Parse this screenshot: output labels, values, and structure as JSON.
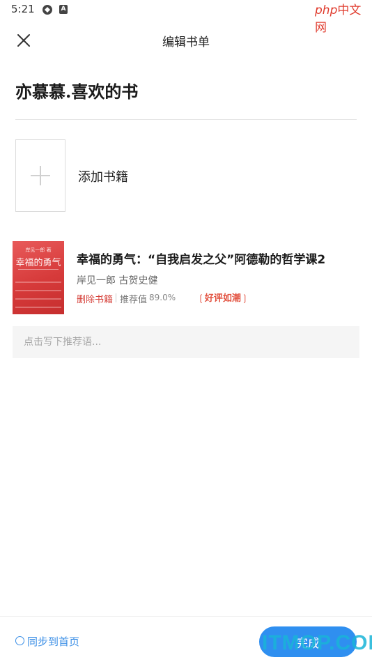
{
  "status_bar": {
    "time": "5:21",
    "icon_b": "A"
  },
  "watermark_top": {
    "brand": "php",
    "suffix": "中文网"
  },
  "header": {
    "title": "编辑书单",
    "close_icon": "close-icon"
  },
  "booklist": {
    "name": "亦慕慕.喜欢的书"
  },
  "add_book": {
    "label": "添加书籍",
    "icon": "plus-icon"
  },
  "book": {
    "cover_top": "岸见一郎 著",
    "cover_title": "幸福的勇气",
    "title": "幸福的勇气：“自我启发之父”阿德勒的哲学课2",
    "authors": "岸见一郎 古贺史健",
    "delete_label": "删除书籍",
    "rec_label": "推荐值",
    "rec_value": "89.0%",
    "badge": "好评如潮"
  },
  "note": {
    "placeholder": "点击写下推荐语..."
  },
  "footer": {
    "sync_label": "同步到首页",
    "done_label": "完成"
  },
  "watermark_bottom": {
    "text": "ITMOP.COM"
  },
  "colors": {
    "accent": "#2f8ff0",
    "danger": "#d6423b",
    "badge": "#e2513f"
  }
}
